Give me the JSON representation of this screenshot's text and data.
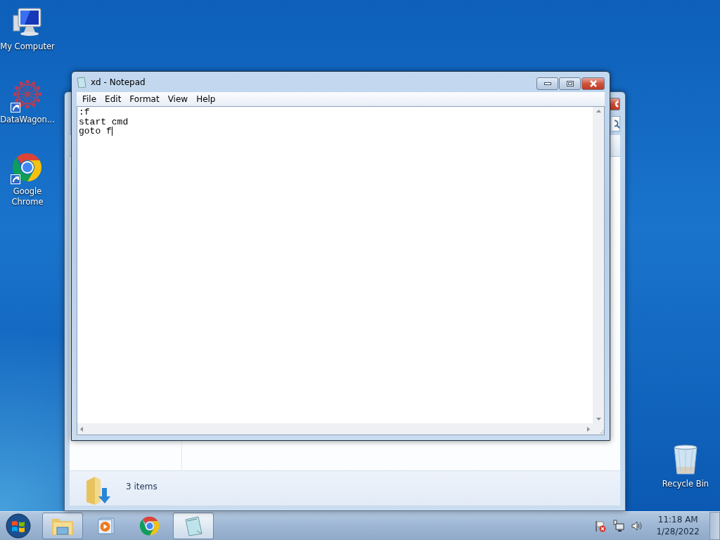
{
  "desktop_icons": [
    {
      "kind": "computer",
      "label": "My Computer",
      "shortcut": false
    },
    {
      "kind": "network-graph",
      "label": "DataWagon...",
      "shortcut": true
    },
    {
      "kind": "chrome",
      "label": "Google Chrome",
      "shortcut": true
    },
    {
      "kind": "recycle-bin",
      "label": "Recycle Bin",
      "shortcut": false
    }
  ],
  "explorer": {
    "status": "3 items"
  },
  "notepad": {
    "title": "xd - Notepad",
    "menu": [
      "File",
      "Edit",
      "Format",
      "View",
      "Help"
    ],
    "lines": [
      ":f",
      "start cmd",
      "goto f"
    ]
  },
  "taskbar": {
    "items": [
      {
        "kind": "explorer",
        "open": true,
        "selected": false
      },
      {
        "kind": "media-player",
        "open": false,
        "selected": false
      },
      {
        "kind": "chrome",
        "open": false,
        "selected": false
      },
      {
        "kind": "notepad",
        "open": true,
        "selected": true
      }
    ],
    "clock": {
      "time": "11:18 AM",
      "date": "1/28/2022"
    }
  }
}
